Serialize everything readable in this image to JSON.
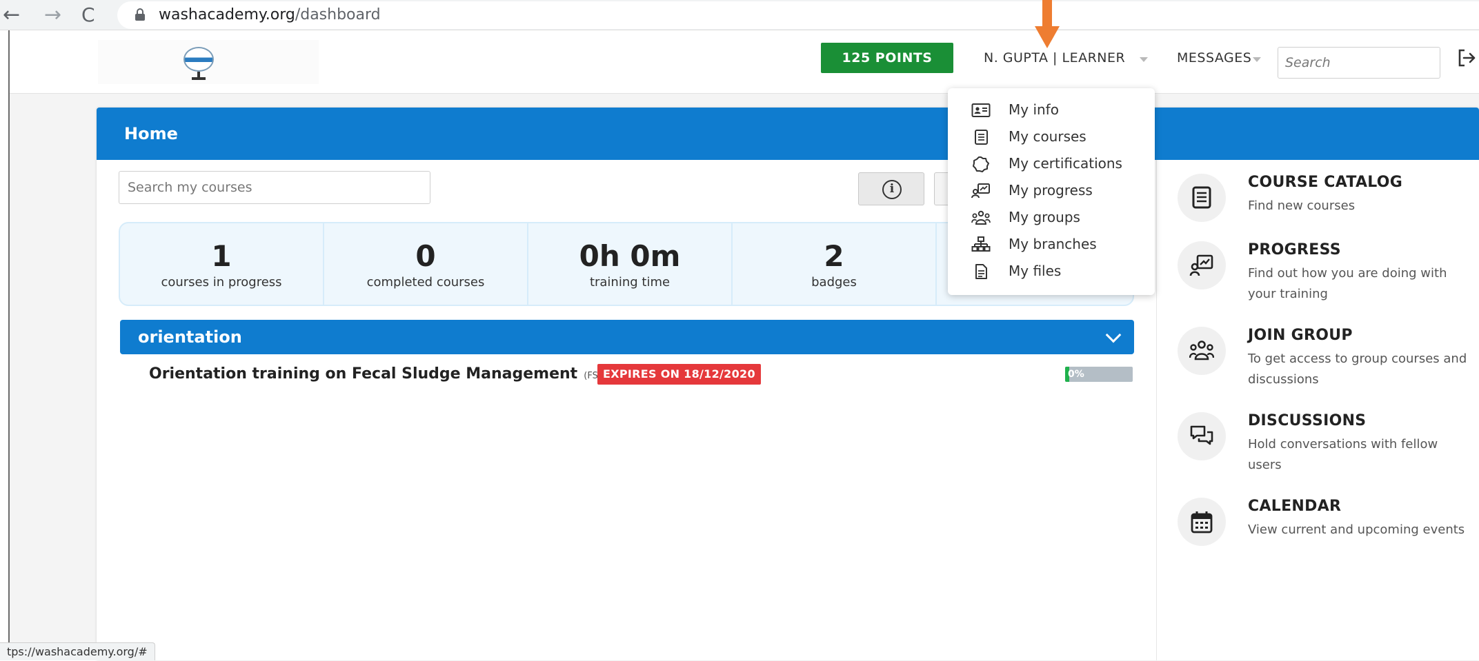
{
  "browser": {
    "back_icon": "←",
    "forward_icon": "→",
    "reload_icon": "C",
    "url_domain": "washacademy.org",
    "url_path": "/dashboard",
    "status_url": "tps://washacademy.org/#"
  },
  "header": {
    "points": "125 POINTS",
    "user_menu": "N. GUPTA | LEARNER",
    "messages": "MESSAGES",
    "search_placeholder": "Search",
    "accent_color": "#1a8f36"
  },
  "user_dropdown": {
    "items": [
      {
        "label": "My info",
        "icon": "id-card-icon"
      },
      {
        "label": "My courses",
        "icon": "course-book-icon"
      },
      {
        "label": "My certifications",
        "icon": "certificate-seal-icon"
      },
      {
        "label": "My progress",
        "icon": "progress-presentation-icon"
      },
      {
        "label": "My groups",
        "icon": "group-people-icon"
      },
      {
        "label": "My branches",
        "icon": "sitemap-icon"
      },
      {
        "label": "My files",
        "icon": "file-icon"
      }
    ]
  },
  "home": {
    "title": "Home",
    "search_placeholder": "Search my courses",
    "header_color": "#0f7ccf",
    "stats": [
      {
        "value": "1",
        "label": "courses in progress"
      },
      {
        "value": "0",
        "label": "completed courses"
      },
      {
        "value": "0h 0m",
        "label": "training time"
      },
      {
        "value": "2",
        "label": "badges"
      }
    ],
    "category": "orientation",
    "course": {
      "name": "Orientation training on Fecal Sludge Management",
      "code": "(FSM101)",
      "expires": "EXPIRES ON 18/12/2020",
      "progress_label": "0%",
      "progress_value": 0.06
    }
  },
  "sidebar": {
    "items": [
      {
        "title": "COURSE CATALOG",
        "desc": "Find new courses",
        "icon": "catalog-book-icon"
      },
      {
        "title": "PROGRESS",
        "desc": "Find out how you are doing with your training",
        "icon": "progress-chart-icon"
      },
      {
        "title": "JOIN GROUP",
        "desc": "To get access to group courses and discussions",
        "icon": "group-icon"
      },
      {
        "title": "DISCUSSIONS",
        "desc": "Hold conversations with fellow users",
        "icon": "chat-bubbles-icon"
      },
      {
        "title": "CALENDAR",
        "desc": "View current and upcoming events",
        "icon": "calendar-icon"
      }
    ]
  }
}
